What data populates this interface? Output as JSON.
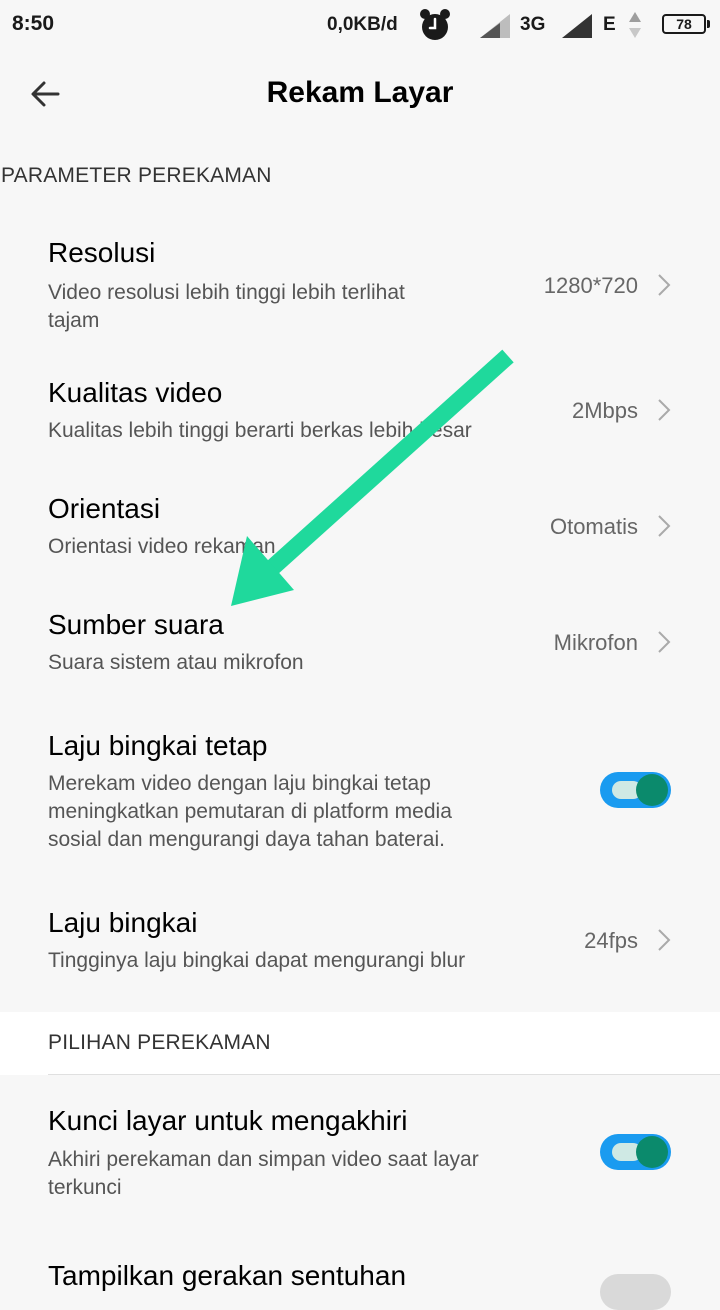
{
  "status_bar": {
    "time": "8:50",
    "data_rate": "0,0KB/d",
    "network_1": "3G",
    "network_2": "E",
    "battery": "78"
  },
  "app_bar": {
    "title": "Rekam Layar"
  },
  "section_1": {
    "header": "PARAMETER PEREKAMAN",
    "items": [
      {
        "title": "Resolusi",
        "desc_line1": "Video resolusi lebih tinggi lebih terlihat",
        "desc_line2": "tajam",
        "value": "1280*720"
      },
      {
        "title": "Kualitas video",
        "desc": "Kualitas lebih tinggi berarti berkas lebih besar",
        "value": "2Mbps"
      },
      {
        "title": "Orientasi",
        "desc": "Orientasi video rekaman",
        "value": "Otomatis"
      },
      {
        "title": "Sumber suara",
        "desc": "Suara sistem atau mikrofon",
        "value": "Mikrofon"
      },
      {
        "title": "Laju bingkai tetap",
        "desc_line1": "Merekam video dengan laju bingkai tetap",
        "desc_line2": "meningkatkan pemutaran di platform media",
        "desc_line3": "sosial dan mengurangi daya tahan baterai.",
        "toggle_on": true
      },
      {
        "title": "Laju bingkai",
        "desc": "Tingginya laju bingkai dapat mengurangi blur",
        "value": "24fps"
      }
    ]
  },
  "section_2": {
    "header": "PILIHAN PEREKAMAN",
    "items": [
      {
        "title": "Kunci layar untuk mengakhiri",
        "desc_line1": "Akhiri perekaman dan simpan video saat layar",
        "desc_line2": "terkunci",
        "toggle_on": true
      },
      {
        "title": "Tampilkan gerakan sentuhan",
        "toggle_on": false
      }
    ]
  },
  "colors": {
    "background": "#f7f7f7",
    "toggle_on_bg": "#1a9bf0",
    "toggle_knob": "#0b8a6c",
    "annotation_arrow": "#1fd99c"
  },
  "icons": {
    "back": "arrow-left-icon",
    "alarm": "alarm-clock-icon",
    "chevron": "chevron-right-icon"
  }
}
